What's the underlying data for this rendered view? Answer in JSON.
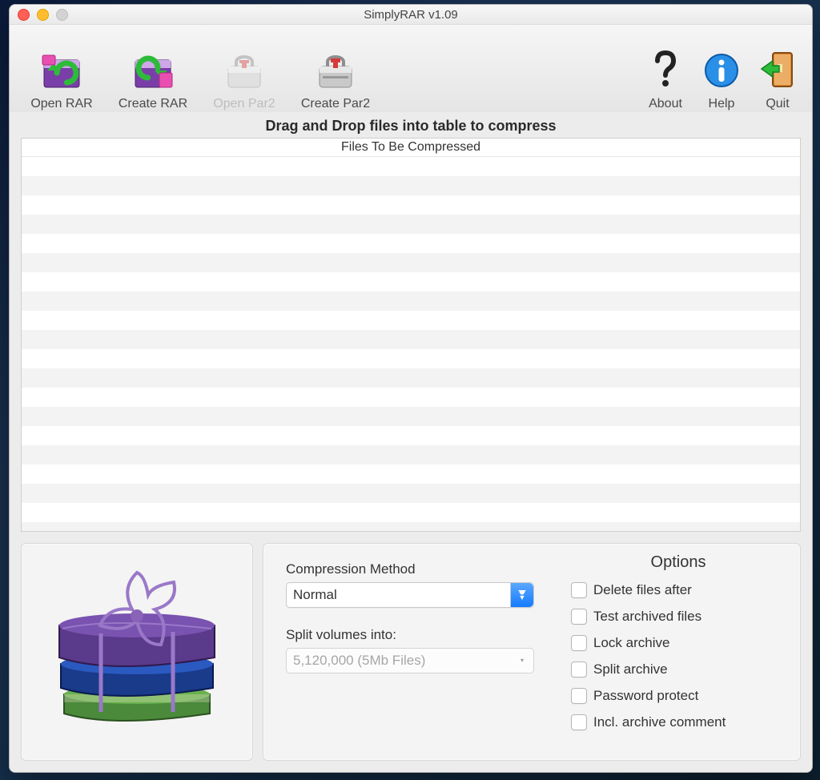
{
  "window": {
    "title": "SimplyRAR v1.09"
  },
  "toolbar": {
    "left": [
      {
        "id": "open-rar",
        "label": "Open RAR",
        "icon": "open-rar-icon",
        "disabled": false
      },
      {
        "id": "create-rar",
        "label": "Create RAR",
        "icon": "create-rar-icon",
        "disabled": false
      },
      {
        "id": "open-par2",
        "label": "Open Par2",
        "icon": "open-par2-icon",
        "disabled": true
      },
      {
        "id": "create-par2",
        "label": "Create Par2",
        "icon": "create-par2-icon",
        "disabled": false
      }
    ],
    "right": [
      {
        "id": "about",
        "label": "About",
        "icon": "about-icon"
      },
      {
        "id": "help",
        "label": "Help",
        "icon": "help-icon"
      },
      {
        "id": "quit",
        "label": "Quit",
        "icon": "quit-icon"
      }
    ]
  },
  "main": {
    "drag_hint": "Drag and Drop files into table to compress",
    "table_header": "Files To Be Compressed"
  },
  "compression": {
    "method_label": "Compression Method",
    "method_value": "Normal",
    "split_label": "Split volumes into:",
    "split_value": "5,120,000 (5Mb Files)"
  },
  "options": {
    "title": "Options",
    "items": [
      {
        "id": "delete-after",
        "label": "Delete files after",
        "checked": false
      },
      {
        "id": "test-archived",
        "label": "Test archived files",
        "checked": false
      },
      {
        "id": "lock-archive",
        "label": "Lock archive",
        "checked": false
      },
      {
        "id": "split-archive",
        "label": "Split archive",
        "checked": false
      },
      {
        "id": "password-protect",
        "label": "Password protect",
        "checked": false
      },
      {
        "id": "incl-comment",
        "label": "Incl. archive comment",
        "checked": false
      }
    ]
  }
}
